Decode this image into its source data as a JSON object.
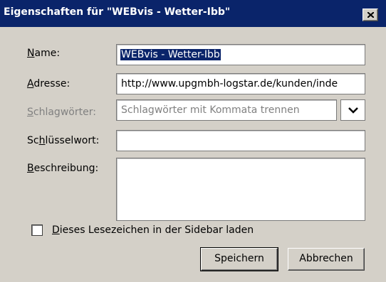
{
  "window": {
    "title": "Eigenschaften für \"WEBvis - Wetter-Ibb\""
  },
  "fields": {
    "name": {
      "label_prefix": "",
      "label_key": "N",
      "label_rest": "ame:",
      "value": "WEBvis - Wetter-Ibb"
    },
    "adresse": {
      "label_prefix": "",
      "label_key": "A",
      "label_rest": "dresse:",
      "value": "http://www.upgmbh-logstar.de/kunden/inde"
    },
    "schlagwoerter": {
      "label_prefix": "",
      "label_key": "S",
      "label_rest": "chlagwörter:",
      "placeholder": "Schlagwörter mit Kommata trennen"
    },
    "schluesselwort": {
      "label_prefix": "Sc",
      "label_key": "h",
      "label_rest": "lüsselwort:",
      "value": ""
    },
    "beschreibung": {
      "label_prefix": "",
      "label_key": "B",
      "label_rest": "eschreibung:",
      "value": ""
    }
  },
  "sidebar_checkbox": {
    "label_key": "D",
    "label_rest": "ieses Lesezeichen in der Sidebar laden",
    "checked": false
  },
  "buttons": {
    "save": "Speichern",
    "cancel": "Abbrechen"
  },
  "icons": {
    "close": "close-icon",
    "dropdown": "chevron-down-icon"
  },
  "colors": {
    "titlebar": "#0a246a",
    "dialog": "#d4d0c8",
    "selection": "#0a246a"
  }
}
